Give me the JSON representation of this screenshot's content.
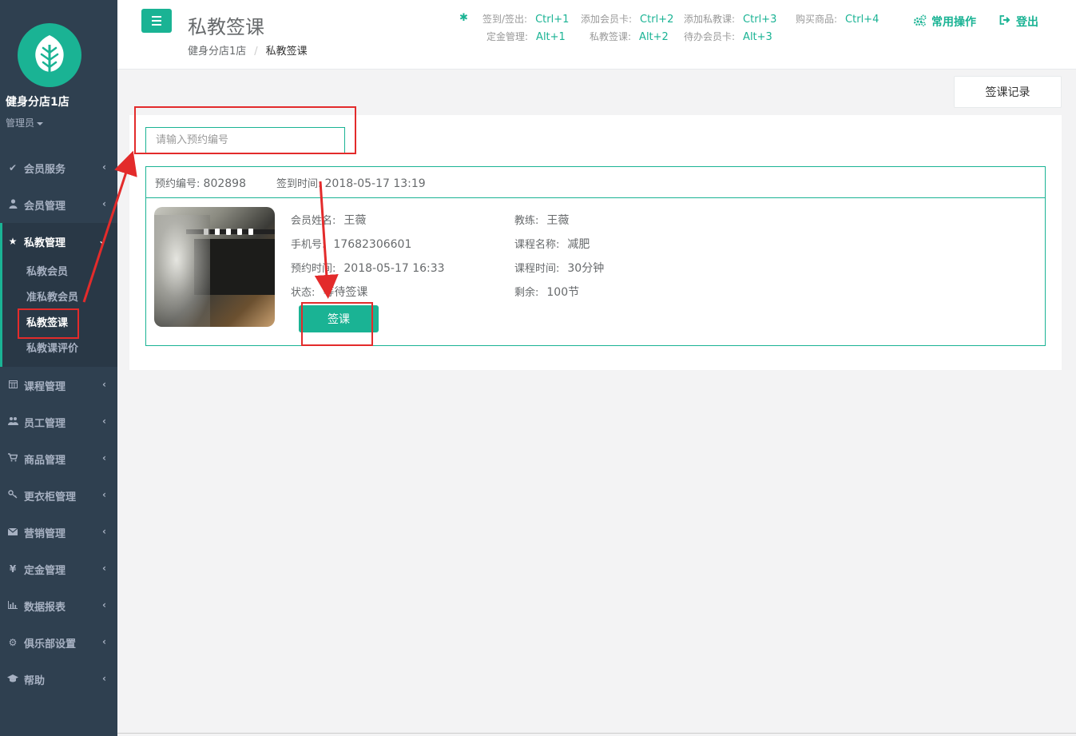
{
  "sidebar": {
    "store_name": "健身分店1店",
    "role": "管理员",
    "items": [
      {
        "label": "会员服务",
        "icon": "check-icon"
      },
      {
        "label": "会员管理",
        "icon": "user-icon"
      },
      {
        "label": "私教管理",
        "icon": "star-icon",
        "sub": [
          "私教会员",
          "准私教会员",
          "私教签课",
          "私教课评价"
        ],
        "current": "私教签课"
      },
      {
        "label": "课程管理",
        "icon": "calendar-icon"
      },
      {
        "label": "员工管理",
        "icon": "users-icon"
      },
      {
        "label": "商品管理",
        "icon": "cart-icon"
      },
      {
        "label": "更衣柜管理",
        "icon": "key-icon"
      },
      {
        "label": "营销管理",
        "icon": "envelope-icon"
      },
      {
        "label": "定金管理",
        "icon": "yen-icon"
      },
      {
        "label": "数据报表",
        "icon": "bar-chart-icon"
      },
      {
        "label": "俱乐部设置",
        "icon": "gear-icon"
      },
      {
        "label": "帮助",
        "icon": "graduation-cap-icon"
      }
    ]
  },
  "header": {
    "title": "私教签课",
    "breadcrumb": [
      "健身分店1店",
      "私教签课"
    ],
    "shortcuts": [
      {
        "label": "签到/签出:",
        "key": "Ctrl+1"
      },
      {
        "label": "添加会员卡:",
        "key": "Ctrl+2"
      },
      {
        "label": "添加私教课:",
        "key": "Ctrl+3"
      },
      {
        "label": "购买商品:",
        "key": "Ctrl+4"
      },
      {
        "label": "定金管理:",
        "key": "Alt+1"
      },
      {
        "label": "私教签课:",
        "key": "Alt+2"
      },
      {
        "label": "待办会员卡:",
        "key": "Alt+3"
      }
    ],
    "common_ops": "常用操作",
    "logout": "登出"
  },
  "main": {
    "record_button": "签课记录",
    "search": {
      "placeholder": "请输入预约编号",
      "value": ""
    },
    "card": {
      "booking_no_label": "预约编号:",
      "booking_no": "802898",
      "checkin_time_label": "签到时间:",
      "checkin_time": "2018-05-17 13:19",
      "member_name_label": "会员姓名:",
      "member_name": "王薇",
      "phone_label": "手机号:",
      "phone": "17682306601",
      "booking_time_label": "预约时间:",
      "booking_time": "2018-05-17 16:33",
      "status_label": "状态:",
      "status": "等待签课",
      "coach_label": "教练:",
      "coach": "王薇",
      "course_label": "课程名称:",
      "course": "减肥",
      "duration_label": "课程时间:",
      "duration": "30分钟",
      "remaining_label": "剩余:",
      "remaining": "100节",
      "signin_button": "签课"
    }
  },
  "colors": {
    "accent": "#1ab394",
    "sidebar": "#2f4050",
    "annotation": "#e32b2b"
  }
}
